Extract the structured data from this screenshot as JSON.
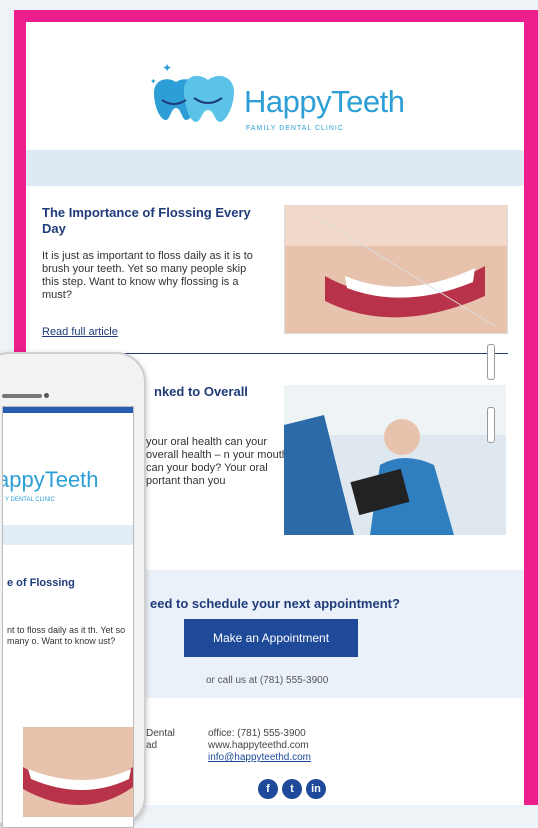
{
  "brand": {
    "name": "HappyTeeth",
    "tagline": "FAMILY DENTAL CLINIC"
  },
  "article1": {
    "title": "The Importance of Flossing Every Day",
    "body": "It is just as important to floss daily as it is to brush your teeth. Yet so many people skip this step. Want to know why flossing is a must?",
    "link": "Read full article"
  },
  "article2": {
    "title_partial": "nked to Overall",
    "body_partial": "your oral health can your overall health – n your mouth can your body? Your oral portant than you"
  },
  "cta": {
    "title_partial": "eed to schedule your next appointment?",
    "button": "Make an Appointment",
    "call": "or call us at (781) 555-3900"
  },
  "footer": {
    "left_partial_1": "Dental",
    "left_partial_2": "ad",
    "office": "office: (781) 555-3900",
    "website": "www.happyteethd.com",
    "email": "info@happyteethd.com"
  },
  "social": [
    "f",
    "t",
    "in"
  ],
  "phone": {
    "brand_partial": "appyTeeth",
    "sub_partial": "Y DENTAL CLINIC",
    "title_partial": "e of Flossing",
    "body_partial": "nt to floss daily as it th. Yet so many o. Want to know ust?"
  },
  "colors": {
    "frame": "#ec1d8c",
    "brand": "#2d9fd6",
    "navy": "#1f3b7a",
    "button": "#1f4a9a"
  }
}
